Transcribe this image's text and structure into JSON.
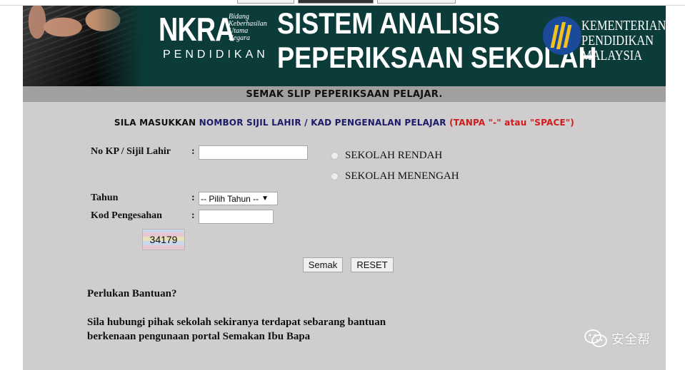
{
  "banner": {
    "nkra": "NKRA",
    "nkra_sub": [
      "Bidang",
      "Keberhasilan",
      "Utama",
      "Negara"
    ],
    "nkra_pendidikan": "PENDIDIKAN",
    "system_line1": "SISTEM ANALISIS",
    "system_line2": "PEPERIKSAAN SEKOLAH",
    "ministry_lines": [
      "KEMENTERIAN",
      "PENDIDIKAN",
      "MALAYSIA"
    ]
  },
  "subtitle": "SEMAK SLIP PEPERIKSAAN PELAJAR.",
  "instruction": {
    "part1": "SILA MASUKKAN ",
    "part2": "NOMBOR SIJIL LAHIR / KAD PENGENALAN PELAJAR ",
    "part3": "(TANPA \"-\" atau \"SPACE\")"
  },
  "form": {
    "kp_label": "No KP / Sijil Lahir",
    "colon": ":",
    "kp_value": "",
    "radio_rendah": "SEKOLAH RENDAH",
    "radio_menengah": "SEKOLAH MENENGAH",
    "tahun_label": "Tahun",
    "tahun_selected": "-- Pilih Tahun --",
    "kod_label": "Kod Pengesahan",
    "kod_value": "",
    "captcha_text": "34179",
    "semak_label": "Semak",
    "reset_label": "RESET"
  },
  "help": {
    "heading": "Perlukan Bantuan?",
    "line1": "Sila hubungi pihak sekolah sekiranya terdapat sebarang bantuan",
    "line2": "berkenaan pengunaan portal Semakan Ibu Bapa"
  },
  "watermark": {
    "text": "安全帮",
    "icon": "wechat-icon"
  },
  "colors": {
    "banner": "#0c3c3a",
    "subbar": "#a1a0a0",
    "page": "#cfcdcd",
    "accent_blue": "#1b1b6a",
    "accent_red": "#d11a1a"
  }
}
